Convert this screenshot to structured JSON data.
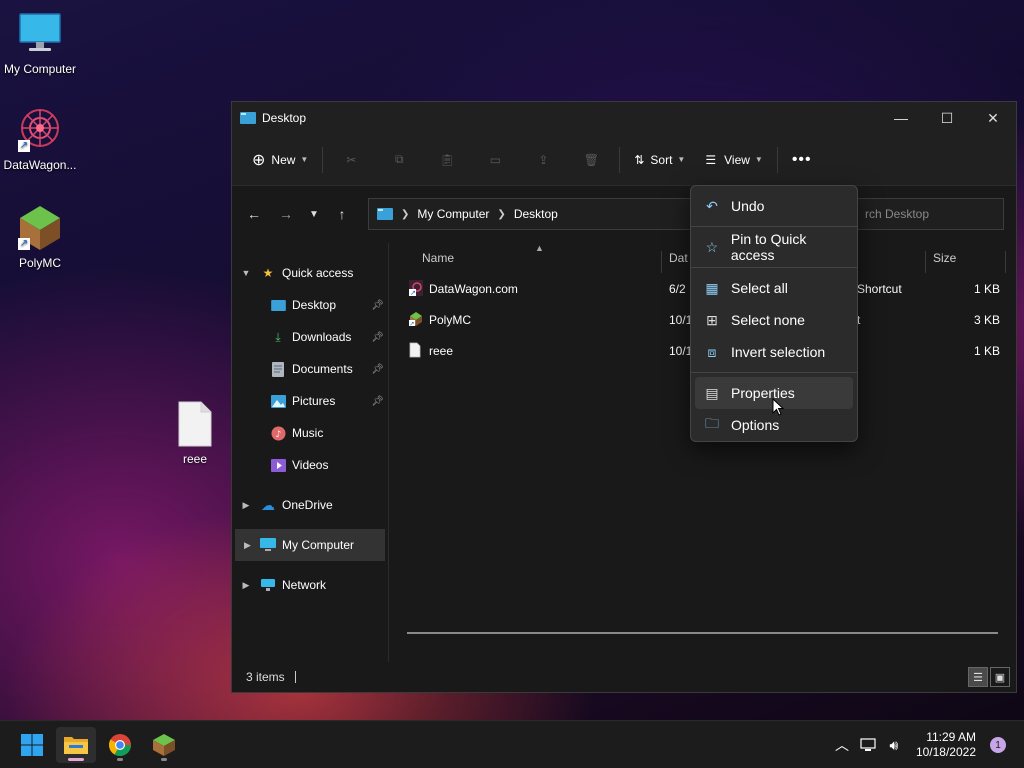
{
  "desktop": {
    "icons": [
      {
        "label": "My Computer"
      },
      {
        "label": "DataWagon..."
      },
      {
        "label": "PolyMC"
      },
      {
        "label": "reee"
      }
    ]
  },
  "window": {
    "title": "Desktop",
    "toolbar": {
      "new_label": "New",
      "sort_label": "Sort",
      "view_label": "View"
    },
    "breadcrumb": [
      "My Computer",
      "Desktop"
    ],
    "search_placeholder": "Search Desktop",
    "search_visible": "rch Desktop",
    "nav": {
      "quick_access": "Quick access",
      "items": [
        {
          "label": "Desktop",
          "pinned": true
        },
        {
          "label": "Downloads",
          "pinned": true
        },
        {
          "label": "Documents",
          "pinned": true
        },
        {
          "label": "Pictures",
          "pinned": true
        },
        {
          "label": "Music",
          "pinned": false
        },
        {
          "label": "Videos",
          "pinned": false
        }
      ],
      "onedrive": "OneDrive",
      "my_computer": "My Computer",
      "network": "Network"
    },
    "columns": {
      "name": "Name",
      "date": "Dat",
      "size": "Size"
    },
    "files": [
      {
        "name": "DataWagon.com",
        "date": "6/2",
        "type": "Shortcut",
        "size": "1 KB"
      },
      {
        "name": "PolyMC",
        "date": "10/1",
        "type": "t",
        "size": "3 KB"
      },
      {
        "name": "reee",
        "date": "10/1",
        "type": "",
        "size": "1 KB"
      }
    ],
    "status": "3 items"
  },
  "context_menu": {
    "items": [
      "Undo",
      "Pin to Quick access",
      "Select all",
      "Select none",
      "Invert selection",
      "Properties",
      "Options"
    ]
  },
  "taskbar": {
    "time": "11:29 AM",
    "date": "10/18/2022",
    "notifications": "1"
  },
  "colors": {
    "accent": "#0078d4",
    "folder": "#f3c13a",
    "taskbar_indicator": "#e6a8d7"
  }
}
